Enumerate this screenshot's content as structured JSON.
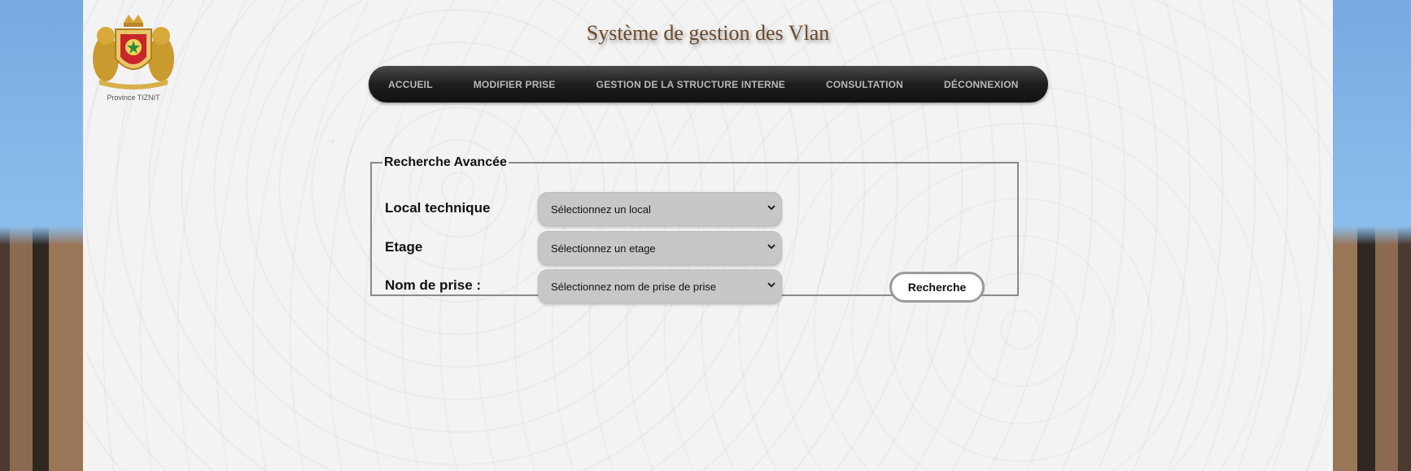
{
  "brand": {
    "title": "Système de gestion des Vlan",
    "logo_caption": "Province TIZNIT",
    "logo_icon": "royal-coat-of-arms-icon"
  },
  "nav": {
    "items": [
      {
        "label": "ACCUEIL"
      },
      {
        "label": "MODIFIER PRISE"
      },
      {
        "label": "GESTION DE LA STRUCTURE INTERNE"
      },
      {
        "label": "CONSULTATION"
      },
      {
        "label": "DÉCONNEXION"
      }
    ]
  },
  "search": {
    "legend": "Recherche Avancée",
    "fields": [
      {
        "label": "Local technique",
        "selected": "Sélectionnez un local"
      },
      {
        "label": "Etage",
        "selected": "Sélectionnez un etage"
      },
      {
        "label": "Nom de prise :",
        "selected": "Sélectionnez nom de prise de prise"
      }
    ],
    "submit_label": "Recherche"
  },
  "colors": {
    "title": "#6b4a2a",
    "nav_text": "#b9b9b9",
    "select_bg": "#c7c7c7"
  }
}
